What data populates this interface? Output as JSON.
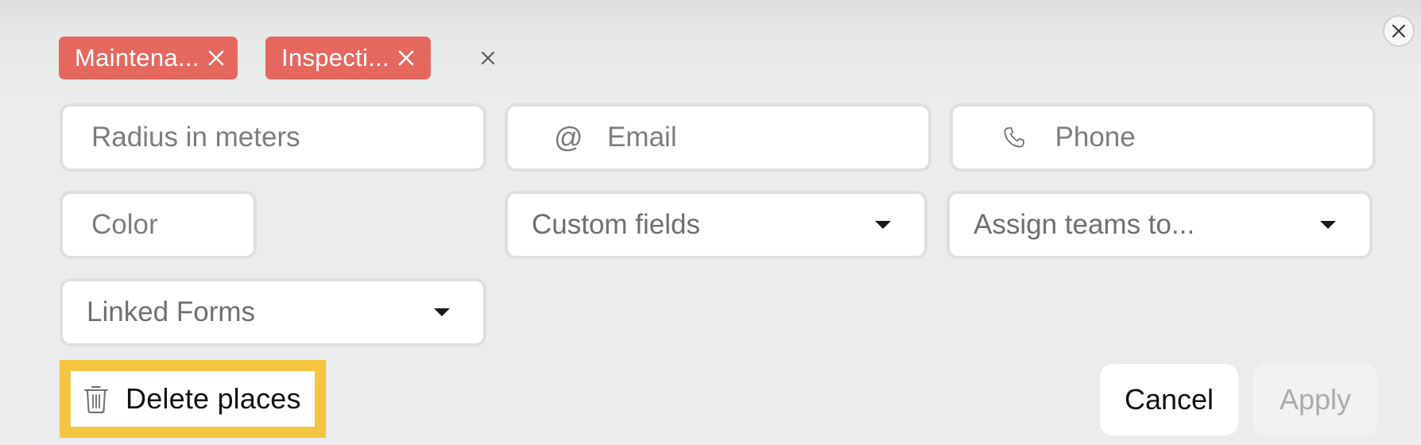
{
  "dialog": {
    "close_icon": "close-icon"
  },
  "filters": {
    "chips": [
      {
        "label": "Maintena...",
        "remove_icon": "close-icon"
      },
      {
        "label": "Inspecti...",
        "remove_icon": "close-icon"
      }
    ],
    "clear_icon": "close-icon"
  },
  "fields": {
    "radius": {
      "placeholder": "Radius in meters",
      "value": ""
    },
    "email": {
      "placeholder": "Email",
      "value": "",
      "icon": "@"
    },
    "phone": {
      "placeholder": "Phone",
      "value": "",
      "icon": "phone-icon"
    },
    "color": {
      "placeholder": "Color",
      "value": ""
    },
    "custom_fields": {
      "label": "Custom fields"
    },
    "assign_teams": {
      "label": "Assign teams to..."
    },
    "linked_forms": {
      "label": "Linked Forms"
    }
  },
  "actions": {
    "delete_label": "Delete places",
    "cancel_label": "Cancel",
    "apply_label": "Apply"
  },
  "colors": {
    "chip_background": "#e5685f",
    "highlight": "#f5c440",
    "apply_disabled_text": "#a9abad"
  }
}
